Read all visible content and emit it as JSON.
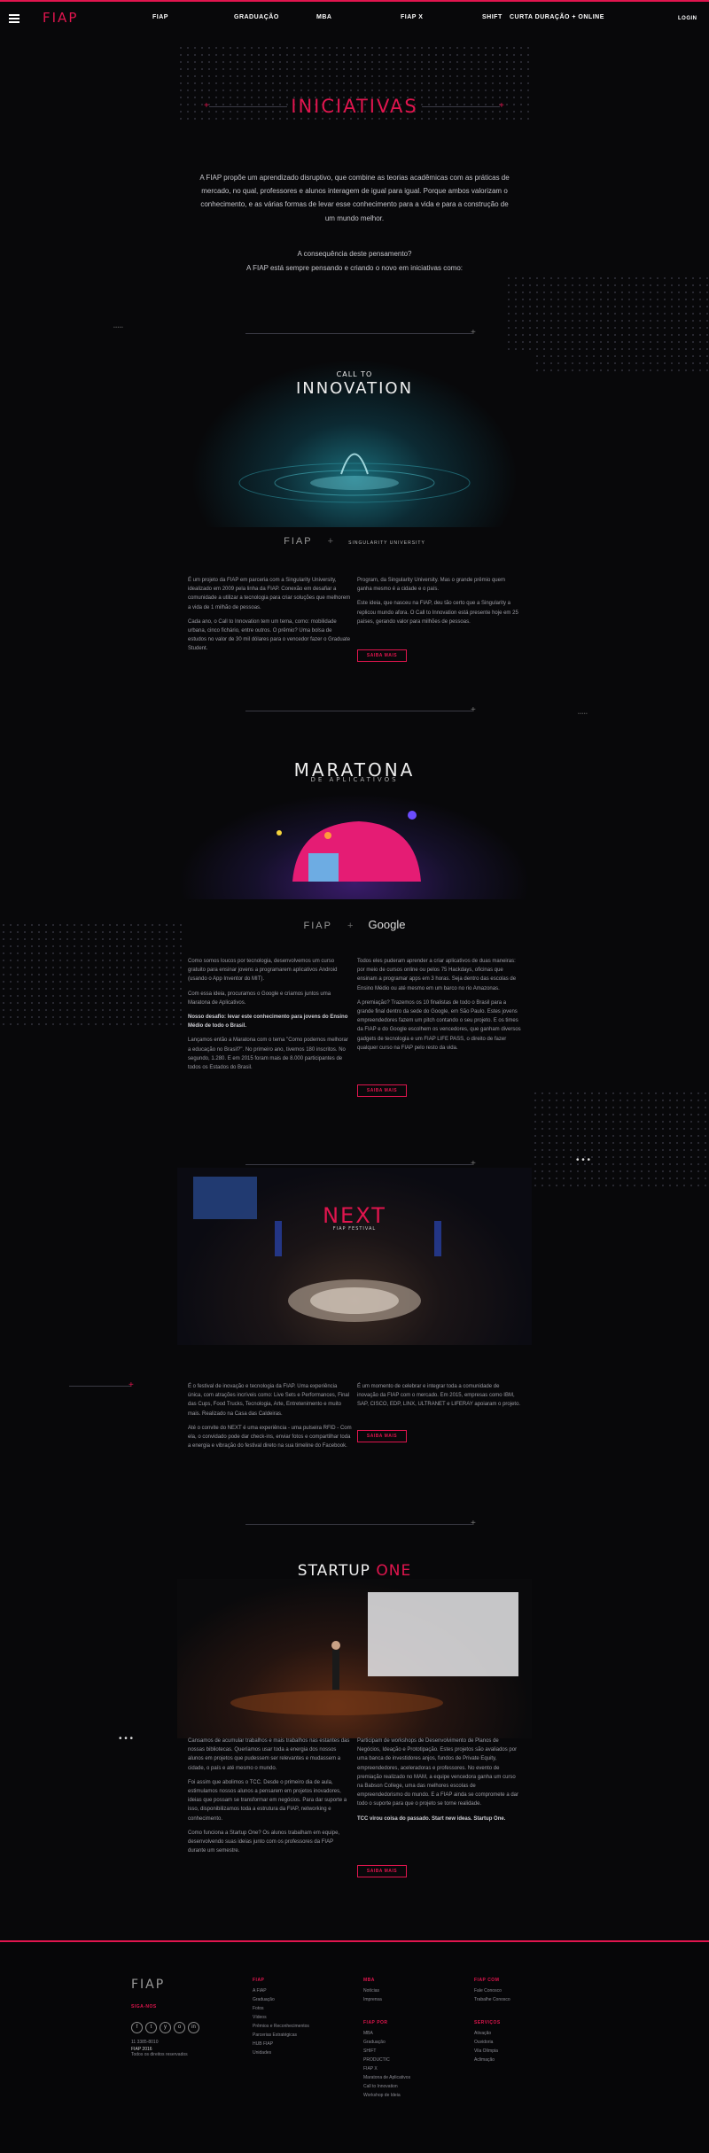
{
  "header": {
    "logo": "FIAP",
    "nav": [
      "FIAP",
      "GRADUAÇÃO",
      "MBA",
      "FIAP X",
      "SHIFT",
      "CURTA DURAÇÃO + ONLINE"
    ],
    "login": "LOGIN"
  },
  "intro": {
    "title": "INICIATIVAS",
    "paragraph": "A FIAP propõe um aprendizado disruptivo, que combine as teorias acadêmicas com as práticas de mercado, no qual, professores e alunos interagem de igual para igual. Porque ambos valorizam o conhecimento, e as várias formas de levar esse conhecimento para a vida e para a construção de um mundo melhor.",
    "question": "A consequência deste pensamento?",
    "answer": "A FIAP está sempre pensando e criando o novo em iniciativas como:"
  },
  "innovation": {
    "kicker": "CALL TO",
    "title": "INNOVATION",
    "partner_left": "FIAP",
    "partner_right": "SINGULARITY UNIVERSITY",
    "col1": [
      "É um projeto da FIAP em parceria com a Singularity University, idealizado em 2009 pela linha da FIAP. Conexão em desafiar a comunidade a utilizar a tecnologia para criar soluções que melhorem a vida de 1 milhão de pessoas.",
      "Cada ano, o Call to Innovation tem um tema, como: mobilidade urbana, cinco fichário, entre outros. O prêmio? Uma bolsa de estudos no valor de 30 mil dólares para o vencedor fazer o Graduate Student."
    ],
    "col2": [
      "Program, da Singularity University. Mas o grande prêmio quem ganha mesmo é a cidade e o país.",
      "Este ideia, que nasceu na FIAP, deu tão certo que a Singularity a replicou mundo afora. O Call to Innovation está presente hoje em 25 países, gerando valor para milhões de pessoas."
    ],
    "button": "SAIBA MAIS"
  },
  "maratona": {
    "title": "MARATONA",
    "subtitle": "DE APLICATIVOS",
    "partner_left": "FIAP",
    "partner_right": "Google",
    "col1": [
      "Como somos loucos por tecnologia, desenvolvemos um curso gratuito para ensinar jovens a programarem aplicativos Android (usando o App Inventor do MIT).",
      "Com essa ideia, procuramos o Google e criamos juntos uma Maratona de Aplicativos.",
      "Nosso desafio: levar este conhecimento para jovens do Ensino Médio de todo o Brasil.",
      "Lançamos então a Maratona com o tema \"Como podemos melhorar a educação no Brasil?\". No primeiro ano, tivemos 180 inscritos. No segundo, 1.280. E em 2015 foram mais de 8.000 participantes de todos os Estados do Brasil."
    ],
    "col2": [
      "Todos eles puderam aprender a criar aplicativos de duas maneiras: por meio de cursos online ou pelos 75 Hackdays, oficinas que ensinam a programar apps em 3 horas. Seja dentro das escolas de Ensino Médio ou até mesmo em um barco no rio Amazonas.",
      "A premiação? Trazemos os 10 finalistas de todo o Brasil para a grande final dentro da sede do Google, em São Paulo. Estes jovens empreendedores fazem um pitch contando o seu projeto. E os times da FIAP e do Google escolhem os vencedores, que ganham diversos gadgets de tecnologia e um FIAP LIFE PASS, o direito de fazer qualquer curso na FIAP pelo resto da vida."
    ],
    "button": "SAIBA MAIS"
  },
  "next": {
    "title": "NEXT",
    "subtitle": "FIAP FESTIVAL",
    "col1": [
      "É o festival de inovação e tecnologia da FIAP. Uma experiência única, com atrações incríveis como: Live Sets e Performances, Final das Cups, Food Trucks, Tecnologia, Arte, Entretenimento e muito mais. Realizado na Casa das Caldeiras.",
      "Até o convite do NEXT é uma experiência - uma pulseira RFID - Com ela, o convidado pode dar check-ins, enviar fotos e compartilhar toda a energia e vibração do festival direto na sua timeline do Facebook."
    ],
    "col2": [
      "É um momento de celebrar e integrar toda a comunidade de inovação da FIAP com o mercado. Em 2015, empresas como IBM, SAP, CISCO, EDP, LINX, ULTRANET e LIFERAY apoiaram o projeto."
    ],
    "button": "SAIBA MAIS"
  },
  "startup": {
    "title_a": "STARTUP",
    "title_b": "ONE",
    "col1": [
      "Cansamos de acumular trabalhos e mais trabalhos nas estantes das nossas bibliotecas. Queríamos usar toda a energia dos nossos alunos em projetos que pudessem ser relevantes e mudassem a cidade, o país e até mesmo o mundo.",
      "Foi assim que abolimos o TCC. Desde o primeiro dia de aula, estimulamos nossos alunos a pensarem em projetos inovadores, ideias que possam se transformar em negócios. Para dar suporte a isso, disponibilizamos toda a estrutura da FIAP, networking e conhecimento.",
      "Como funciona a Startup One? Os alunos trabalham em equipe, desenvolvendo suas ideias junto com os professores da FIAP durante um semestre."
    ],
    "col2": [
      "Participam de workshops de Desenvolvimento de Planos de Negócios, Ideação e Prototipação. Estes projetos são avaliados por uma banca de investidores anjos, fundos de Private Equity, empreendedores, aceleradoras e professores. No evento de premiação realizado no MAM, a equipe vencedora ganha um curso na Babson College, uma das melhores escolas de empreendedorismo do mundo. E a FIAP ainda se compromete a dar todo o suporte para que o projeto se torne realidade.",
      "TCC virou coisa do passado. Start new ideas. Startup One."
    ],
    "button": "SAIBA MAIS"
  },
  "footer": {
    "logo": "FIAP",
    "follow": "SIGA-NOS",
    "social": [
      "f",
      "t",
      "y",
      "o",
      "in"
    ],
    "phone": "11 3385-8010",
    "copyright_1": "FIAP 2016",
    "copyright_2": "Todos os direitos reservados",
    "columns": [
      {
        "head": "FIAP",
        "items": [
          "A FIAP",
          "Graduação",
          "Fotos",
          "Vídeos",
          "Prêmios e Reconhecimentos",
          "Parcerias Estratégicas",
          "HUB FIAP",
          "Unidades"
        ]
      },
      {
        "head": "MBA",
        "items": [
          "Notícias",
          "Imprensa"
        ]
      },
      {
        "head": "FIAP POR",
        "items": [
          "MBA",
          "Graduação",
          "SHIFT",
          "PRODUCTIC",
          "FIAP X",
          "Maratona de Aplicativos",
          "Call to Innovation",
          "Workshop de Ideia"
        ]
      },
      {
        "head": "FIAP COM",
        "items": [
          "Fale Conosco",
          "Trabalhe Conosco"
        ]
      },
      {
        "head": "SERVIÇOS",
        "items": [
          "Ativação",
          "Ouvidoria",
          "Vila Olímpia",
          "Aclimação"
        ]
      }
    ]
  }
}
